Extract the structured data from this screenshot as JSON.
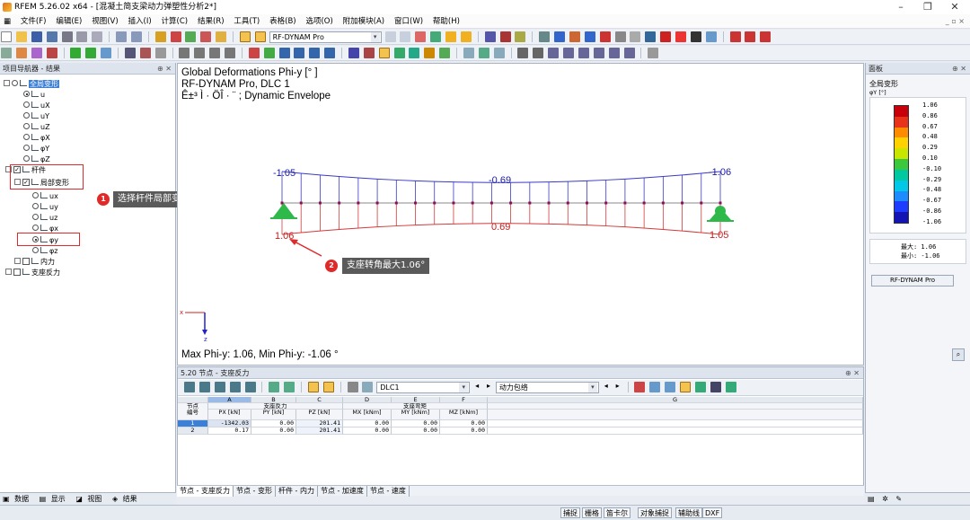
{
  "window": {
    "title": "RFEM 5.26.02 x64 - [混凝土简支梁动力弹塑性分析2*]"
  },
  "menu": [
    "文件(F)",
    "编辑(E)",
    "视图(V)",
    "插入(I)",
    "计算(C)",
    "结果(R)",
    "工具(T)",
    "表格(B)",
    "选项(O)",
    "附加模块(A)",
    "窗口(W)",
    "帮助(H)"
  ],
  "toolbar": {
    "module_combo": "RF-DYNAM Pro"
  },
  "navigator": {
    "title": "项目导航器 - 结果",
    "items": [
      "全局变形",
      "u",
      "uX",
      "uY",
      "uZ",
      "φX",
      "φY",
      "φZ",
      "杆件",
      "局部变形",
      "ux",
      "uy",
      "uz",
      "φx",
      "φy",
      "φz",
      "内力",
      "支座反力"
    ],
    "tabs": [
      "数据",
      "显示",
      "视图",
      "结果"
    ]
  },
  "annotations": [
    {
      "num": "1",
      "text": "选择杆件局部变形“φ y”"
    },
    {
      "num": "2",
      "text": "支座转角最大1.06°"
    }
  ],
  "view": {
    "line1": "Global Deformations Phi-y [° ]",
    "line2": "RF-DYNAM Pro, DLC 1",
    "line3": "Ê±³ Ì · ÖÎ   · ¨ ; Dynamic Envelope",
    "labels": {
      "top_left": "-1.05",
      "top_mid": "-0.69",
      "top_right": "-1.06",
      "bot_left": "1.06",
      "bot_mid": "0.69",
      "bot_right": "1.05"
    },
    "axis_x": "x",
    "axis_z": "z",
    "footer": "Max Phi-y: 1.06, Min Phi-y: -1.06 °"
  },
  "panel": {
    "title": "面板",
    "subtitle": "全局变形",
    "unit": "φY [°]",
    "legend": [
      "1.06",
      "0.86",
      "0.67",
      "0.48",
      "0.29",
      "0.10",
      "-0.10",
      "-0.29",
      "-0.48",
      "-0.67",
      "-0.86",
      "-1.06"
    ],
    "legend_colors": [
      "#c8000a",
      "#e8321a",
      "#ff8c00",
      "#ffd200",
      "#c8e600",
      "#3cc83c",
      "#00c8a0",
      "#00c8e6",
      "#1e8cff",
      "#1e3cff",
      "#1414b4"
    ],
    "max_label": "最大:  1.06",
    "min_label": "最小: -1.06",
    "button": "RF-DYNAM Pro"
  },
  "table": {
    "title": "5.20 节点 - 支座反力",
    "combo_case": "DLC1",
    "combo_type": "动力包络",
    "col_letters": [
      "A",
      "B",
      "C",
      "D",
      "E",
      "F",
      "G"
    ],
    "group_headers": [
      "节点\n编号",
      "支座反力",
      "",
      "",
      "支座弯矩",
      "",
      ""
    ],
    "sub_headers": [
      "",
      "PX [kN]",
      "PY [kN]",
      "PZ [kN]",
      "MX [kNm]",
      "MY [kNm]",
      "MZ [kNm]"
    ],
    "rows": [
      {
        "no": "1",
        "px": "-1342.03",
        "py": "0.00",
        "pz": "201.41",
        "mx": "0.00",
        "my": "0.00",
        "mz": "0.00"
      },
      {
        "no": "2",
        "px": "0.17",
        "py": "0.00",
        "pz": "201.41",
        "mx": "0.00",
        "my": "0.00",
        "mz": "0.00"
      }
    ],
    "tabs": [
      "节点 - 支座反力",
      "节点 - 变形",
      "杆件 - 内力",
      "节点 - 加速度",
      "节点 - 速度"
    ]
  },
  "status": [
    "捕捉",
    "栅格",
    "笛卡尔",
    "对象捕捉",
    "辅助线",
    "DXF"
  ]
}
